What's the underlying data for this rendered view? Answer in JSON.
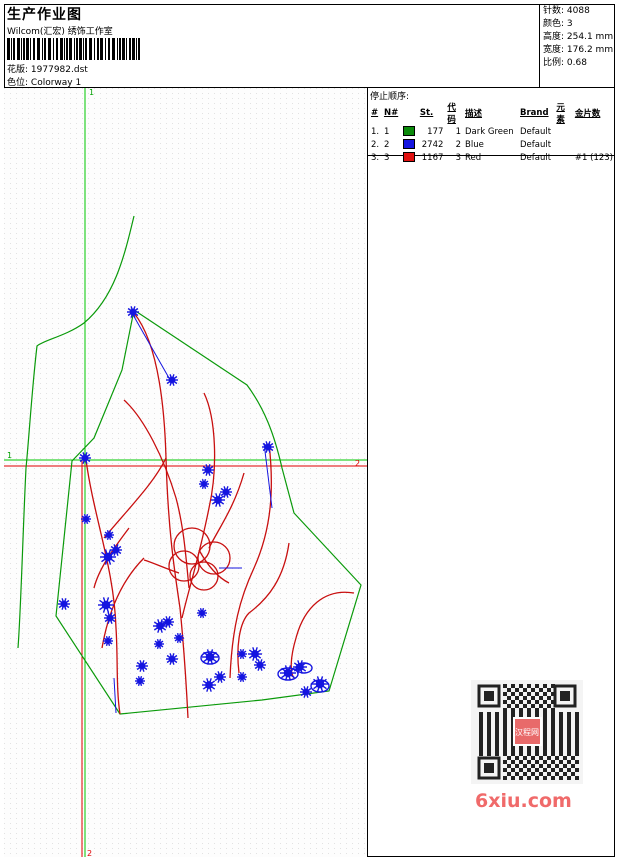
{
  "header": {
    "title": "生产作业图",
    "company": "Wilcom(汇宏) 绣饰工作室",
    "design_label": "花版:",
    "design_value": "1977982.dst",
    "colorway_label": "色位:",
    "colorway_value": "Colorway 1"
  },
  "stats": [
    {
      "label": "针数:",
      "value": "4088"
    },
    {
      "label": "颜色:",
      "value": "3"
    },
    {
      "label": "高度:",
      "value": "254.1 mm"
    },
    {
      "label": "宽度:",
      "value": "176.2 mm"
    },
    {
      "label": "比例:",
      "value": "0.68"
    }
  ],
  "stops": {
    "title": "停止顺序:",
    "columns": [
      "#",
      "N#",
      "",
      "St.",
      "代码",
      "描述",
      "Brand",
      "元素",
      "金片数"
    ],
    "rows": [
      {
        "num": "1.",
        "n": "1",
        "color": "#0a8a0a",
        "st": "177",
        "code": "1",
        "desc": "Dark Green",
        "brand": "Default",
        "element": "",
        "sequins": ""
      },
      {
        "num": "2.",
        "n": "2",
        "color": "#1515e0",
        "st": "2742",
        "code": "2",
        "desc": "Blue",
        "brand": "Default",
        "element": "",
        "sequins": ""
      },
      {
        "num": "3.",
        "n": "3",
        "color": "#e01010",
        "st": "1167",
        "code": "3",
        "desc": "Red",
        "brand": "Default",
        "element": "",
        "sequins": "#1 (123)"
      }
    ]
  },
  "axes": {
    "vertical_top": "1",
    "vertical_bottom": "2",
    "horizontal_left": "1",
    "horizontal_right": "2"
  },
  "watermark": {
    "text": "6xiu.com",
    "seal_text": "汉程网"
  },
  "colors": {
    "outline_green": "#0a9a0a",
    "blue": "#1515e0",
    "red": "#d01010",
    "axis_green": "#00c800",
    "axis_red": "#e00000"
  }
}
